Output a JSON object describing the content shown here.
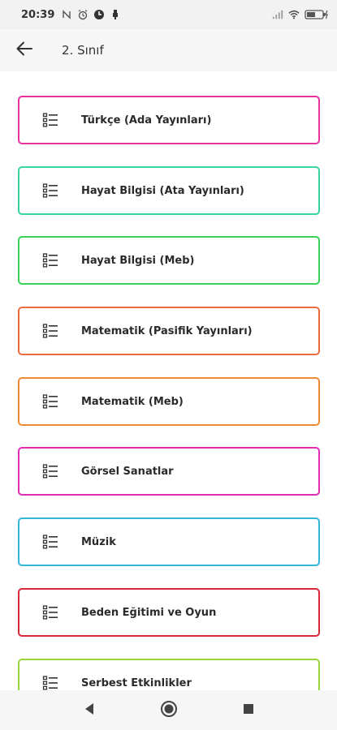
{
  "status_bar": {
    "time": "20:39",
    "battery": "battery-charging-icon"
  },
  "app_bar": {
    "back_icon": "arrow-left-icon",
    "title": "2. Sınıf"
  },
  "list": {
    "items": [
      {
        "label": "Türkçe (Ada Yayınları)",
        "color": "#e8339f"
      },
      {
        "label": "Hayat Bilgisi (Ata Yayınları)",
        "color": "#36d3a5"
      },
      {
        "label": "Hayat Bilgisi (Meb)",
        "color": "#39d35a"
      },
      {
        "label": "Matematik (Pasifik Yayınları)",
        "color": "#ec6a3c"
      },
      {
        "label": "Matematik (Meb)",
        "color": "#ef8a30"
      },
      {
        "label": "Görsel Sanatlar",
        "color": "#e22bb1"
      },
      {
        "label": "Müzik",
        "color": "#32b7d8"
      },
      {
        "label": "Beden Eğitimi ve Oyun",
        "color": "#d9283a"
      },
      {
        "label": "Serbest Etkinlikler",
        "color": "#9ad63a"
      }
    ]
  },
  "nav_bar": {
    "back": "triangle-back-icon",
    "home": "circle-home-icon",
    "recents": "square-recents-icon"
  }
}
